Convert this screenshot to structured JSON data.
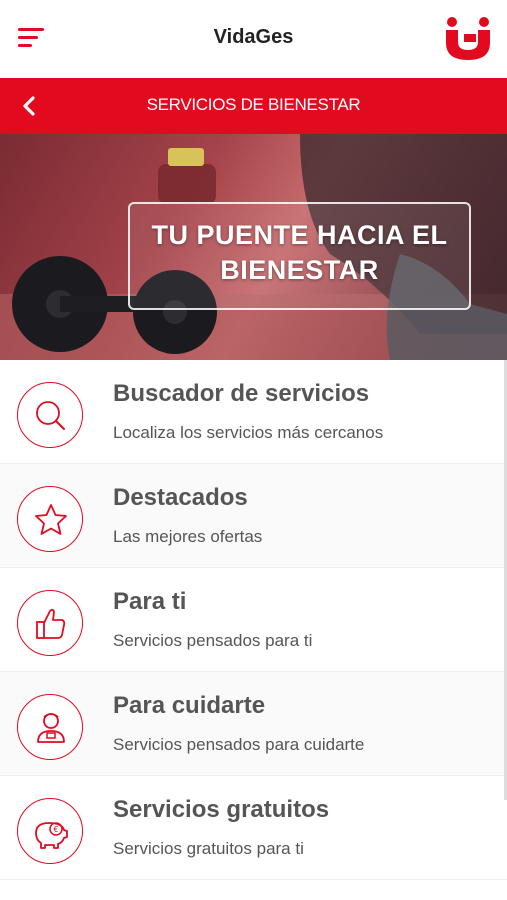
{
  "header": {
    "app_title": "VidaGes",
    "menu_icon": "hamburger-menu-icon",
    "logo_icon": "brand-logo-icon"
  },
  "subheader": {
    "title": "SERVICIOS DE BIENESTAR",
    "back_icon": "chevron-left-icon"
  },
  "hero": {
    "text_line1": "TU PUENTE HACIA EL",
    "text_line2": "BIENESTAR"
  },
  "menu_items": [
    {
      "title": "Buscador de servicios",
      "description": "Localiza los servicios más cercanos",
      "icon": "search-icon"
    },
    {
      "title": "Destacados",
      "description": "Las mejores ofertas",
      "icon": "star-icon"
    },
    {
      "title": "Para ti",
      "description": "Servicios pensados para ti",
      "icon": "thumbs-up-icon"
    },
    {
      "title": "Para cuidarte",
      "description": "Servicios pensados para cuidarte",
      "icon": "person-icon"
    },
    {
      "title": "Servicios gratuitos",
      "description": "Servicios gratuitos para ti",
      "icon": "piggy-bank-icon"
    }
  ],
  "colors": {
    "brand_red": "#e30a1f",
    "text_gray": "#555555"
  }
}
